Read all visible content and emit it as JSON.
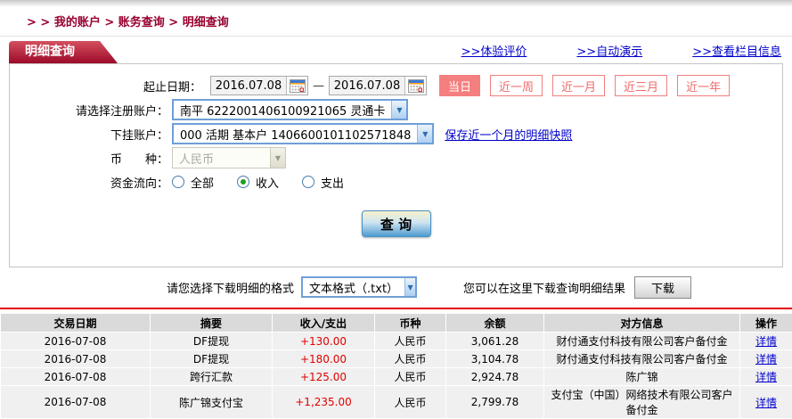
{
  "breadcrumb": {
    "text": "> > 我的账户 > 账务查询 > 明细查询"
  },
  "tab_title": "明细查询",
  "header_links": [
    {
      "label": ">>体验评价"
    },
    {
      "label": ">>自动演示"
    },
    {
      "label": ">>查看栏目信息"
    }
  ],
  "form": {
    "date_label": "起止日期：",
    "date_from": "2016.07.08",
    "date_to": "2016.07.08",
    "date_separator": "—",
    "quick_ranges": [
      {
        "label": "当日",
        "active": true
      },
      {
        "label": "近一周",
        "active": false
      },
      {
        "label": "近一月",
        "active": false
      },
      {
        "label": "近三月",
        "active": false
      },
      {
        "label": "近一年",
        "active": false
      }
    ],
    "register_account": {
      "label": "请选择注册账户：",
      "value": "南平 6222001406100921065 灵通卡"
    },
    "sub_account": {
      "label": "下挂账户：",
      "value": "000 活期 基本户 1406600101102571848"
    },
    "snapshot_link": "保存近一个月的明细快照",
    "currency": {
      "label": "币　　种：",
      "value": "人民币",
      "disabled": true
    },
    "flow": {
      "label": "资金流向：",
      "options": [
        {
          "label": "全部",
          "selected": false
        },
        {
          "label": "收入",
          "selected": true
        },
        {
          "label": "支出",
          "selected": false
        }
      ]
    },
    "query_button": "查 询"
  },
  "download": {
    "format_label": "请您选择下载明细的格式",
    "format_value": "文本格式（.txt）",
    "hint": "您可以在这里下载查询明细结果",
    "button": "下载"
  },
  "table": {
    "headers": [
      "交易日期",
      "摘要",
      "收入/支出",
      "币种",
      "余额",
      "对方信息",
      "操作"
    ],
    "detail_label": "详情",
    "rows": [
      {
        "date": "2016-07-08",
        "summary": "DF提现",
        "amount": "+130.00",
        "currency": "人民币",
        "balance": "3,061.28",
        "counterparty": "财付通支付科技有限公司客户备付金"
      },
      {
        "date": "2016-07-08",
        "summary": "DF提现",
        "amount": "+180.00",
        "currency": "人民币",
        "balance": "3,104.78",
        "counterparty": "财付通支付科技有限公司客户备付金"
      },
      {
        "date": "2016-07-08",
        "summary": "跨行汇款",
        "amount": "+125.00",
        "currency": "人民币",
        "balance": "2,924.78",
        "counterparty": "陈广锦"
      },
      {
        "date": "2016-07-08",
        "summary": "陈广锦支付宝",
        "amount": "+1,235.00",
        "currency": "人民币",
        "balance": "2,799.78",
        "counterparty": "支付宝（中国）网络技术有限公司客户备付金"
      }
    ]
  },
  "colors": {
    "brand_red": "#9c0a28",
    "breadcrumb_red": "#98002e",
    "accent_salmon": "#f57f7f",
    "link_blue": "#0000cc",
    "amount_red": "#e00000",
    "select_border_blue": "#6f9fd8",
    "table_header_gray": "#dadada",
    "table_row_gray": "#f0f0f0",
    "divider_red": "#e60000"
  }
}
